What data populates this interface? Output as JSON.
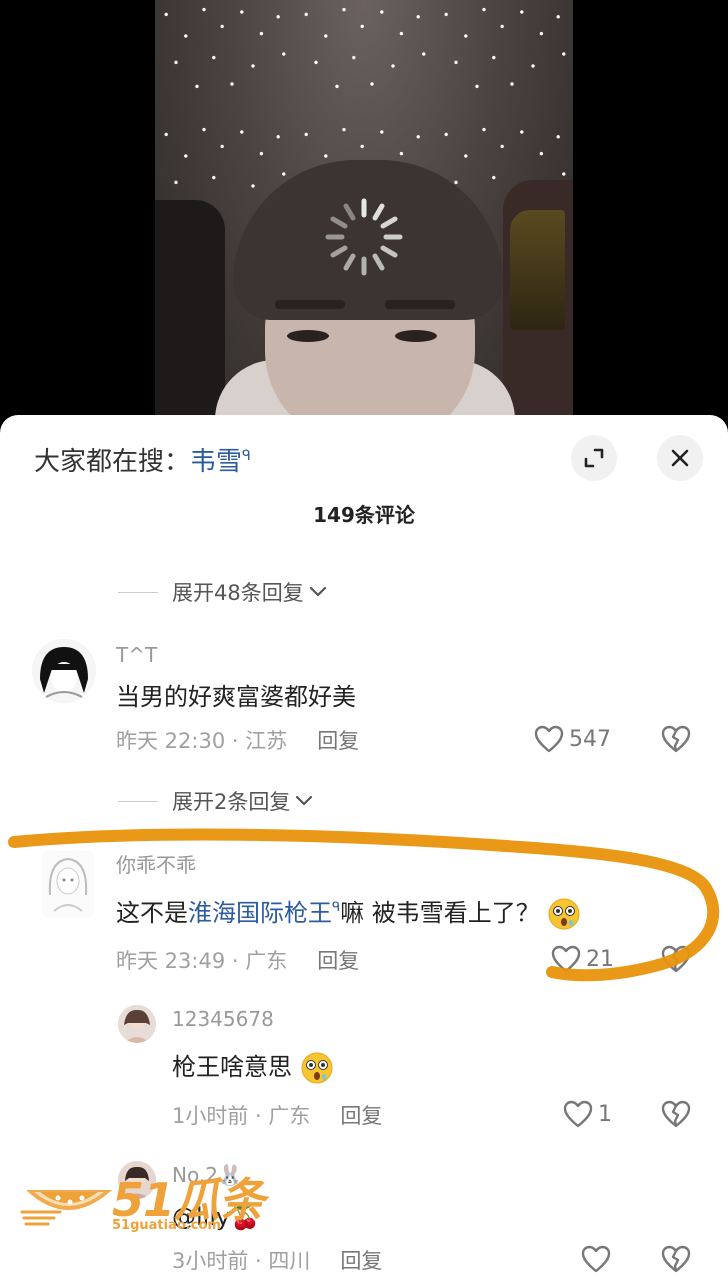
{
  "search": {
    "prefix": "大家都在搜：",
    "term": "韦雪",
    "mark": "ᑫ"
  },
  "header": {
    "count_title": "149条评论"
  },
  "expand_top": {
    "label": "展开48条回复"
  },
  "comments": [
    {
      "user": "T^T",
      "text": "当男的好爽富婆都好美",
      "meta": "昨天 22:30 · 江苏",
      "reply": "回复",
      "likes": "547"
    },
    {
      "user": "你乖不乖",
      "text_a": "这不是",
      "text_link": "淮海国际枪王",
      "text_mark": "ᑫ",
      "text_b": "嘛 被韦雪看上了？",
      "meta": "昨天 23:49 · 广东",
      "reply": "回复",
      "likes": "21"
    }
  ],
  "expand_mid": {
    "label": "展开2条回复"
  },
  "replies": [
    {
      "user": "12345678",
      "text": "枪王啥意思",
      "meta": "1小时前 · 广东",
      "reply": "回复",
      "likes": "1"
    },
    {
      "user": "No.2🐰",
      "text": "@lily🍒",
      "meta": "3小时前 · 四川",
      "reply": "回复",
      "likes": ""
    }
  ],
  "watermark": {
    "brand": "51瓜条",
    "url": "51guatiao.com"
  },
  "colors": {
    "link": "#2c5c9e",
    "annotation": "#e8920c",
    "meta": "#a0a0a0"
  }
}
